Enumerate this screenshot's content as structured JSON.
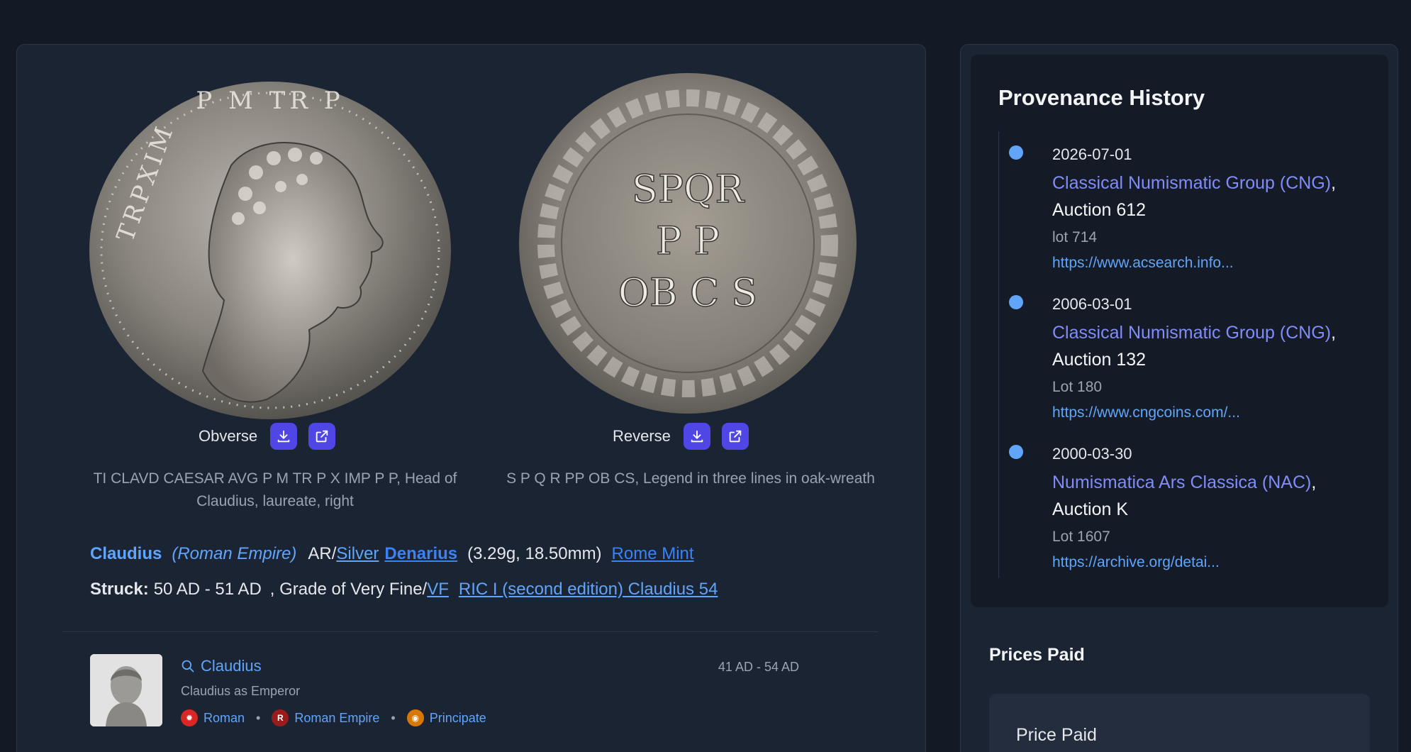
{
  "coin": {
    "obverse": {
      "label": "Obverse",
      "legend": "TI CLAVD CAESAR AVG P M TR P X IMP P P, Head of Claudius, laureate, right",
      "image_alt": "Obverse of Claudius denarius, laureate head right"
    },
    "reverse": {
      "label": "Reverse",
      "legend": "S P Q R PP OB CS, Legend in three lines in oak-wreath",
      "image_alt": "Reverse with SPQR P P OB C S in oak wreath",
      "coin_text": [
        "SPQR",
        "P  P",
        "OB C S"
      ]
    },
    "download_icon": "download-icon",
    "open_icon": "external-link-icon",
    "ruler": "Claudius",
    "empire": "(Roman Empire)",
    "metal_prefix": "AR/",
    "metal": "Silver",
    "denomination": "Denarius",
    "weight_size": "(3.29g, 18.50mm)",
    "mint": "Rome Mint",
    "struck_label": "Struck:",
    "struck_dates": "50 AD - 51 AD",
    "grade_text": ", Grade of Very Fine/",
    "grade_abbr": "VF",
    "reference": "RIC I (second edition) Claudius 54"
  },
  "ruler_card": {
    "name": "Claudius",
    "subtitle": "Claudius as Emperor",
    "dates": "41 AD - 54 AD",
    "tags": [
      {
        "label": "Roman",
        "icon_color": "#dc2626",
        "icon_text": ""
      },
      {
        "label": "Roman Empire",
        "icon_color": "#991b1b",
        "icon_text": "R"
      },
      {
        "label": "Principate",
        "icon_color": "#d97706",
        "icon_text": ""
      }
    ],
    "separator": "•"
  },
  "provenance": {
    "title": "Provenance History",
    "entries": [
      {
        "date": "2026-07-01",
        "house": "Classical Numismatic Group (CNG)",
        "auction": "Auction 612",
        "lot": "lot 714",
        "url": "https://www.acsearch.info..."
      },
      {
        "date": "2006-03-01",
        "house": "Classical Numismatic Group (CNG)",
        "auction": "Auction 132",
        "lot": "Lot 180",
        "url": "https://www.cngcoins.com/..."
      },
      {
        "date": "2000-03-30",
        "house": "Numismatica Ars Classica (NAC)",
        "auction": "Auction K",
        "lot": "Lot 1607",
        "url": "https://archive.org/detai..."
      }
    ]
  },
  "prices": {
    "title": "Prices Paid",
    "box_label": "Price Paid"
  }
}
